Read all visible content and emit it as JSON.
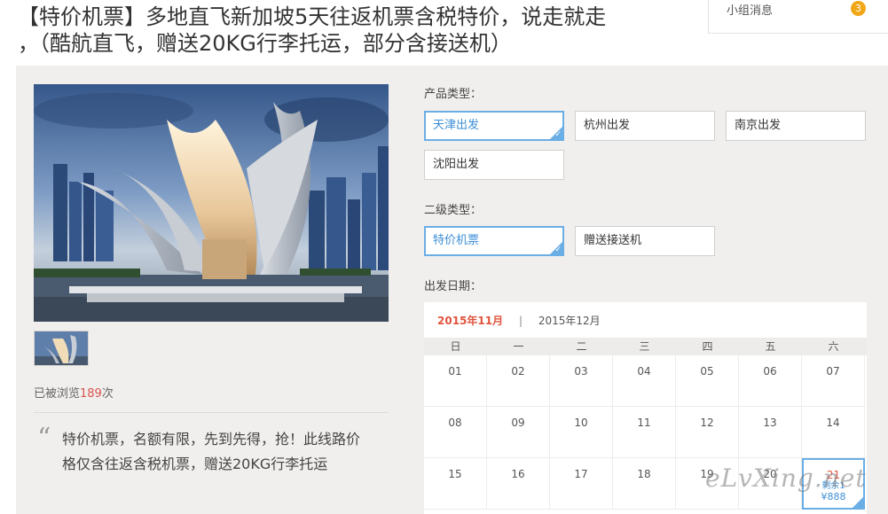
{
  "product": {
    "title_line1": "【特价机票】多地直飞新加坡5天往返机票含税特价，说走就走",
    "title_line2": "，（酷航直飞，赠送20KG行李托运，部分含接送机）"
  },
  "header": {
    "group_message_label": "小组消息",
    "group_message_count": "3"
  },
  "stats": {
    "views_prefix": "已被浏览",
    "views_count": "189",
    "views_suffix": "次"
  },
  "description": {
    "quote_mark": "“",
    "text": "特价机票，名额有限，先到先得，抢！此线路价格仅含往返含税机票，赠送20KG行李托运"
  },
  "options": {
    "product_type_label": "产品类型：",
    "product_types": [
      "天津出发",
      "杭州出发",
      "南京出发",
      "沈阳出发"
    ],
    "product_type_selected": "天津出发",
    "sub_type_label": "二级类型：",
    "sub_types": [
      "特价机票",
      "赠送接送机"
    ],
    "sub_type_selected": "特价机票",
    "date_label": "出发日期："
  },
  "calendar": {
    "months": [
      "2015年11月",
      "2015年12月"
    ],
    "active_month": "2015年11月",
    "separator": "|",
    "weekdays": [
      "日",
      "一",
      "二",
      "三",
      "四",
      "五",
      "六"
    ],
    "days": [
      "01",
      "02",
      "03",
      "04",
      "05",
      "06",
      "07",
      "08",
      "09",
      "10",
      "11",
      "12",
      "13",
      "14",
      "15",
      "16",
      "17",
      "18",
      "19",
      "20",
      "21"
    ],
    "selected_day": "21",
    "selected_sub": "剩余1",
    "selected_price": "¥888"
  },
  "watermark": "eLvXing.net",
  "colors": {
    "accent_blue": "#6aaee6",
    "highlight_red": "#e0553e",
    "badge_orange": "#f0a818",
    "panel_bg": "#f1efed"
  }
}
